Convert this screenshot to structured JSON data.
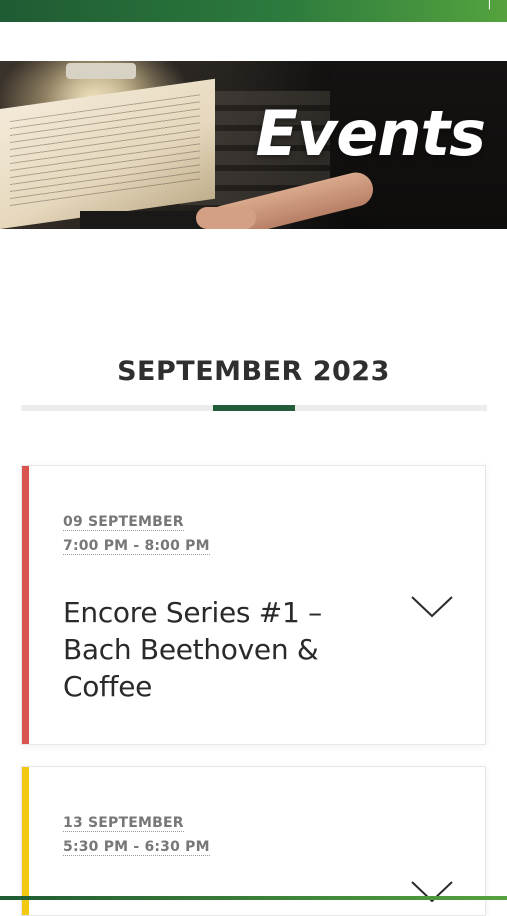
{
  "hero": {
    "title": "Events"
  },
  "month": {
    "heading": "SEPTEMBER 2023"
  },
  "events": [
    {
      "date": "09 SEPTEMBER",
      "time": "7:00 PM - 8:00 PM",
      "title": "Encore Series #1 – Bach Beethoven & Coffee",
      "stripe_color": "#d9534f"
    },
    {
      "date": "13 SEPTEMBER",
      "time": "5:30 PM - 6:30 PM",
      "title": "",
      "stripe_color": "#f2c811"
    }
  ],
  "icons": {
    "expand": "chevron-down-icon"
  },
  "colors": {
    "brand_green": "#235c3a",
    "top_bar_start": "#1f5b33",
    "top_bar_end": "#55a23e"
  }
}
